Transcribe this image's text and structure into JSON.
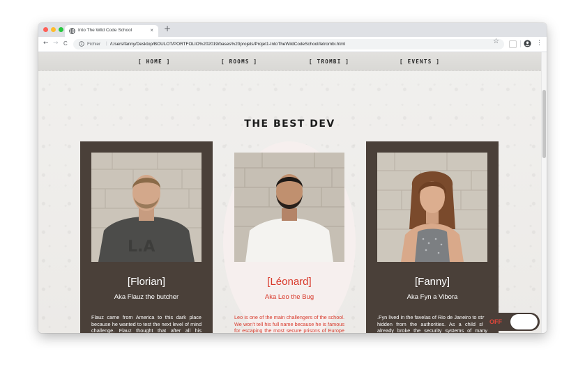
{
  "browser": {
    "tab_title": "Into The Wild Code School",
    "tab_close": "×",
    "new_tab": "+",
    "url_scheme": "Fichier",
    "url_separator": "|",
    "url": "/Users/fanny/Desktop/BOULOT/PORTFOLIO%202019/bases%20projets/Projet1-IntoTheWildCodeSchool/letrombi.html",
    "back": "←",
    "forward": "→",
    "reload": "C",
    "star": "☆",
    "menu": "⋮",
    "traffic_light_colors": [
      "#ff5f57",
      "#febc2e",
      "#28c840"
    ]
  },
  "nav": {
    "items": [
      {
        "label": "[ HOME ]"
      },
      {
        "label": "[ ROOMS ]"
      },
      {
        "label": "[ TROMBI ]"
      },
      {
        "label": "[ EVENTS ]"
      }
    ]
  },
  "page": {
    "title": "THE BEST DEV"
  },
  "cards": [
    {
      "name": "[Florian]",
      "aka": "Aka Flauz the butcher",
      "bio": "Flauz came from America to this dark place because he wanted to test the next level of mind challenge. Flauz thought that after all his adventures in the rough territories of his land nothing would beat him. What he didn't expect, like many others, is that he",
      "style": "dark"
    },
    {
      "name": "[Léonard]",
      "aka": "Aka Leo the Bug",
      "bio": "Leo is one of the main challengers of the school. We won't tell his full name because he is famous for escaping the most secure prisons of Europe and now he is on the wanted list of Interpol. He looks tough but this might change in a few weeks as a",
      "style": "light"
    },
    {
      "name": "[Fanny]",
      "aka": "Aka Fyn a Vibora",
      "bio": ".Fyn lived in the favelas of Rio de Janeiro to stay hidden from the authorities. As a child she already broke the security systems of many governments to acces their secret databases. Now she is a famous cyber activist and she came to the School to stay",
      "style": "dark"
    }
  ],
  "toggle": {
    "label": "OFF"
  },
  "colors": {
    "card_dark": "#4a4039",
    "card_light": "#f6efee",
    "accent_red": "#d8392b"
  }
}
